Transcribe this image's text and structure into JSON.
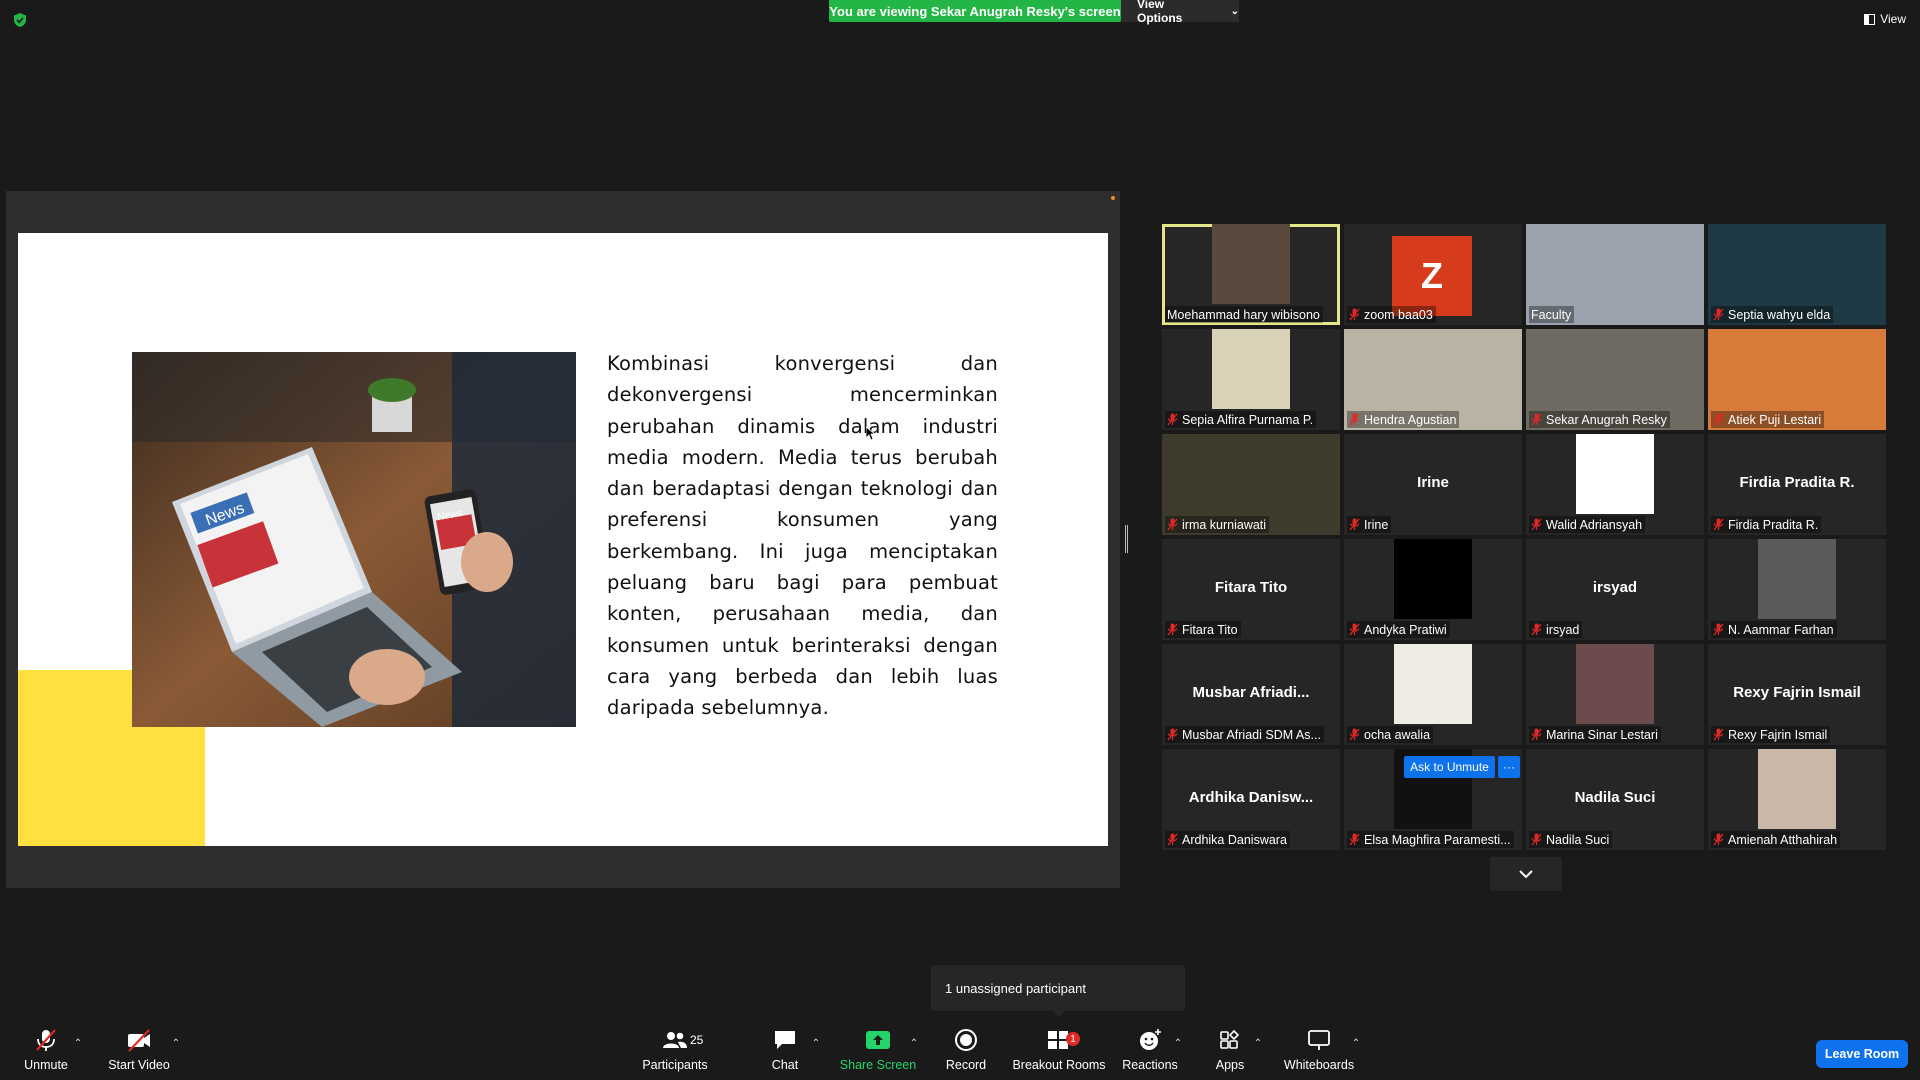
{
  "top": {
    "share_banner": "You are viewing Sekar Anugrah Resky's screen",
    "view_options": "View Options",
    "view_label": "View"
  },
  "slide": {
    "text": "Kombinasi konvergensi dan dekonvergensi mencerminkan perubahan dinamis dalam industri media modern. Media terus berubah dan beradaptasi dengan teknologi dan preferensi konsumen yang berkembang. Ini juga menciptakan peluang baru bagi para pembuat konten, perusahaan media, dan konsumen untuk berinteraksi dengan cara yang berbeda dan lebih luas daripada sebelumnya.",
    "photo_label_1": "News",
    "photo_label_2": "News",
    "accent_color": "#ffe041"
  },
  "gallery": {
    "tiles": [
      {
        "name": "Moehammad hary wibisono",
        "big": "",
        "muted": false,
        "active": true
      },
      {
        "name": "zoom baa03",
        "big": "",
        "muted": true,
        "avatar": "Z"
      },
      {
        "name": "Faculty",
        "big": "",
        "muted": false
      },
      {
        "name": "Septia wahyu elda",
        "big": "",
        "muted": true
      },
      {
        "name": "Sepia Alfira Purnama P.",
        "big": "",
        "muted": true
      },
      {
        "name": "Hendra Agustian",
        "big": "",
        "muted": true
      },
      {
        "name": "Sekar Anugrah Resky",
        "big": "",
        "muted": true
      },
      {
        "name": "Atiek Puji Lestari",
        "big": "",
        "muted": true
      },
      {
        "name": "irma kurniawati",
        "big": "",
        "muted": true
      },
      {
        "name": "Irine",
        "big": "Irine",
        "muted": true
      },
      {
        "name": "Walid Adriansyah",
        "big": "",
        "muted": true
      },
      {
        "name": "Firdia Pradita R.",
        "big": "Firdia Pradita R.",
        "muted": true
      },
      {
        "name": "Fitara Tito",
        "big": "Fitara Tito",
        "muted": true
      },
      {
        "name": "Andyka Pratiwi",
        "big": "",
        "muted": true
      },
      {
        "name": "irsyad",
        "big": "irsyad",
        "muted": true
      },
      {
        "name": "N. Aammar Farhan",
        "big": "",
        "muted": true
      },
      {
        "name": "Musbar Afriadi SDM As...",
        "big": "Musbar Afriadi...",
        "muted": true
      },
      {
        "name": "ocha awalia",
        "big": "",
        "muted": true
      },
      {
        "name": "Marina Sinar Lestari",
        "big": "",
        "muted": true
      },
      {
        "name": "Rexy Fajrin Ismail",
        "big": "Rexy Fajrin Ismail",
        "muted": true
      },
      {
        "name": "Ardhika Daniswara",
        "big": "Ardhika Danisw...",
        "muted": true
      },
      {
        "name": "Elsa Maghfira Paramesti...",
        "big": "",
        "muted": true
      },
      {
        "name": "Nadila Suci",
        "big": "Nadila Suci",
        "muted": true
      },
      {
        "name": "Amienah Atthahirah",
        "big": "",
        "muted": true
      }
    ],
    "ask_to_unmute": "Ask to Unmute",
    "more": "···"
  },
  "tooltip": {
    "unassigned": "1 unassigned participant"
  },
  "toolbar": {
    "unmute": "Unmute",
    "start_video": "Start Video",
    "participants": "Participants",
    "participants_count": "25",
    "chat": "Chat",
    "share_screen": "Share Screen",
    "record": "Record",
    "breakout_rooms": "Breakout Rooms",
    "breakout_badge": "1",
    "reactions": "Reactions",
    "apps": "Apps",
    "whiteboards": "Whiteboards",
    "leave_room": "Leave Room"
  }
}
